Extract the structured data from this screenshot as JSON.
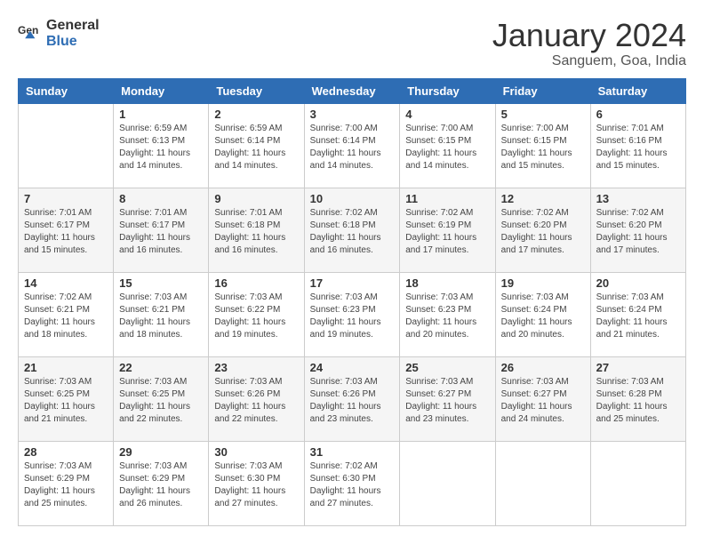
{
  "header": {
    "logo_line1": "General",
    "logo_line2": "Blue",
    "title": "January 2024",
    "subtitle": "Sanguem, Goa, India"
  },
  "days_of_week": [
    "Sunday",
    "Monday",
    "Tuesday",
    "Wednesday",
    "Thursday",
    "Friday",
    "Saturday"
  ],
  "weeks": [
    [
      {
        "day": "",
        "info": ""
      },
      {
        "day": "1",
        "info": "Sunrise: 6:59 AM\nSunset: 6:13 PM\nDaylight: 11 hours\nand 14 minutes."
      },
      {
        "day": "2",
        "info": "Sunrise: 6:59 AM\nSunset: 6:14 PM\nDaylight: 11 hours\nand 14 minutes."
      },
      {
        "day": "3",
        "info": "Sunrise: 7:00 AM\nSunset: 6:14 PM\nDaylight: 11 hours\nand 14 minutes."
      },
      {
        "day": "4",
        "info": "Sunrise: 7:00 AM\nSunset: 6:15 PM\nDaylight: 11 hours\nand 14 minutes."
      },
      {
        "day": "5",
        "info": "Sunrise: 7:00 AM\nSunset: 6:15 PM\nDaylight: 11 hours\nand 15 minutes."
      },
      {
        "day": "6",
        "info": "Sunrise: 7:01 AM\nSunset: 6:16 PM\nDaylight: 11 hours\nand 15 minutes."
      }
    ],
    [
      {
        "day": "7",
        "info": "Sunrise: 7:01 AM\nSunset: 6:17 PM\nDaylight: 11 hours\nand 15 minutes."
      },
      {
        "day": "8",
        "info": "Sunrise: 7:01 AM\nSunset: 6:17 PM\nDaylight: 11 hours\nand 16 minutes."
      },
      {
        "day": "9",
        "info": "Sunrise: 7:01 AM\nSunset: 6:18 PM\nDaylight: 11 hours\nand 16 minutes."
      },
      {
        "day": "10",
        "info": "Sunrise: 7:02 AM\nSunset: 6:18 PM\nDaylight: 11 hours\nand 16 minutes."
      },
      {
        "day": "11",
        "info": "Sunrise: 7:02 AM\nSunset: 6:19 PM\nDaylight: 11 hours\nand 17 minutes."
      },
      {
        "day": "12",
        "info": "Sunrise: 7:02 AM\nSunset: 6:20 PM\nDaylight: 11 hours\nand 17 minutes."
      },
      {
        "day": "13",
        "info": "Sunrise: 7:02 AM\nSunset: 6:20 PM\nDaylight: 11 hours\nand 17 minutes."
      }
    ],
    [
      {
        "day": "14",
        "info": "Sunrise: 7:02 AM\nSunset: 6:21 PM\nDaylight: 11 hours\nand 18 minutes."
      },
      {
        "day": "15",
        "info": "Sunrise: 7:03 AM\nSunset: 6:21 PM\nDaylight: 11 hours\nand 18 minutes."
      },
      {
        "day": "16",
        "info": "Sunrise: 7:03 AM\nSunset: 6:22 PM\nDaylight: 11 hours\nand 19 minutes."
      },
      {
        "day": "17",
        "info": "Sunrise: 7:03 AM\nSunset: 6:23 PM\nDaylight: 11 hours\nand 19 minutes."
      },
      {
        "day": "18",
        "info": "Sunrise: 7:03 AM\nSunset: 6:23 PM\nDaylight: 11 hours\nand 20 minutes."
      },
      {
        "day": "19",
        "info": "Sunrise: 7:03 AM\nSunset: 6:24 PM\nDaylight: 11 hours\nand 20 minutes."
      },
      {
        "day": "20",
        "info": "Sunrise: 7:03 AM\nSunset: 6:24 PM\nDaylight: 11 hours\nand 21 minutes."
      }
    ],
    [
      {
        "day": "21",
        "info": "Sunrise: 7:03 AM\nSunset: 6:25 PM\nDaylight: 11 hours\nand 21 minutes."
      },
      {
        "day": "22",
        "info": "Sunrise: 7:03 AM\nSunset: 6:25 PM\nDaylight: 11 hours\nand 22 minutes."
      },
      {
        "day": "23",
        "info": "Sunrise: 7:03 AM\nSunset: 6:26 PM\nDaylight: 11 hours\nand 22 minutes."
      },
      {
        "day": "24",
        "info": "Sunrise: 7:03 AM\nSunset: 6:26 PM\nDaylight: 11 hours\nand 23 minutes."
      },
      {
        "day": "25",
        "info": "Sunrise: 7:03 AM\nSunset: 6:27 PM\nDaylight: 11 hours\nand 23 minutes."
      },
      {
        "day": "26",
        "info": "Sunrise: 7:03 AM\nSunset: 6:27 PM\nDaylight: 11 hours\nand 24 minutes."
      },
      {
        "day": "27",
        "info": "Sunrise: 7:03 AM\nSunset: 6:28 PM\nDaylight: 11 hours\nand 25 minutes."
      }
    ],
    [
      {
        "day": "28",
        "info": "Sunrise: 7:03 AM\nSunset: 6:29 PM\nDaylight: 11 hours\nand 25 minutes."
      },
      {
        "day": "29",
        "info": "Sunrise: 7:03 AM\nSunset: 6:29 PM\nDaylight: 11 hours\nand 26 minutes."
      },
      {
        "day": "30",
        "info": "Sunrise: 7:03 AM\nSunset: 6:30 PM\nDaylight: 11 hours\nand 27 minutes."
      },
      {
        "day": "31",
        "info": "Sunrise: 7:02 AM\nSunset: 6:30 PM\nDaylight: 11 hours\nand 27 minutes."
      },
      {
        "day": "",
        "info": ""
      },
      {
        "day": "",
        "info": ""
      },
      {
        "day": "",
        "info": ""
      }
    ]
  ]
}
